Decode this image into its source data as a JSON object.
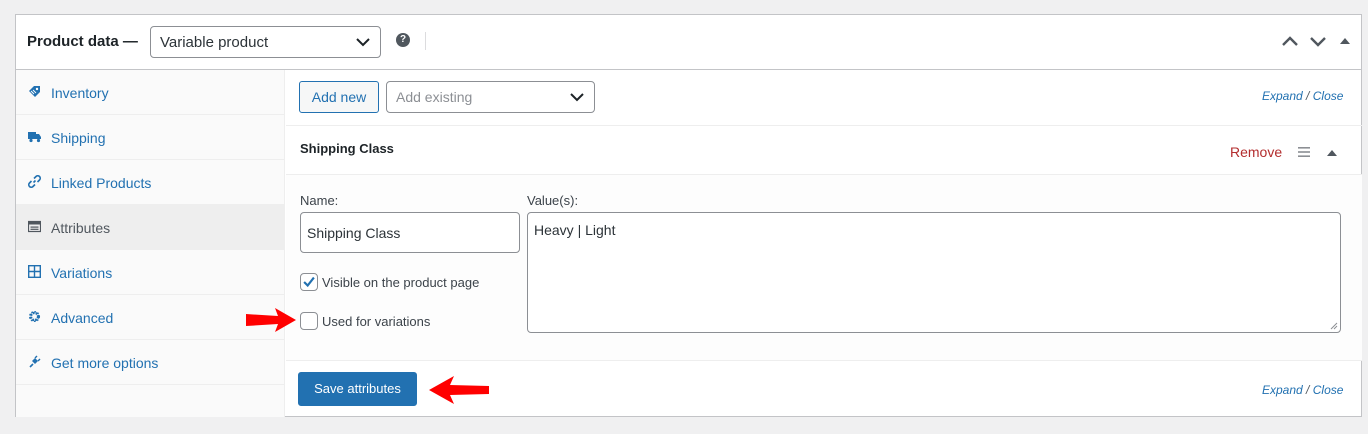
{
  "header": {
    "title": "Product data —",
    "product_type": "Variable product",
    "help": "?"
  },
  "sidebar": {
    "items": [
      {
        "label": "Inventory",
        "icon": "tag-icon"
      },
      {
        "label": "Shipping",
        "icon": "truck-icon"
      },
      {
        "label": "Linked Products",
        "icon": "link-icon"
      },
      {
        "label": "Attributes",
        "icon": "list-view-icon",
        "active": true
      },
      {
        "label": "Variations",
        "icon": "grid-icon"
      },
      {
        "label": "Advanced",
        "icon": "gear-icon"
      },
      {
        "label": "Get more options",
        "icon": "plugin-icon"
      }
    ]
  },
  "toolbar": {
    "add_new": "Add new",
    "add_existing_placeholder": "Add existing",
    "expand": "Expand",
    "separator": "/",
    "close": "Close"
  },
  "attribute": {
    "title": "Shipping Class",
    "remove": "Remove",
    "name_label": "Name:",
    "name_value": "Shipping Class",
    "values_label": "Value(s):",
    "values_value": "Heavy | Light",
    "visible_label": "Visible on the product page",
    "visible_checked": true,
    "variations_label": "Used for variations",
    "variations_checked": false
  },
  "footer": {
    "save": "Save attributes"
  },
  "colors": {
    "accent": "#2271b1",
    "remove": "#b32d2e",
    "annotation_arrow": "#ff0000"
  }
}
